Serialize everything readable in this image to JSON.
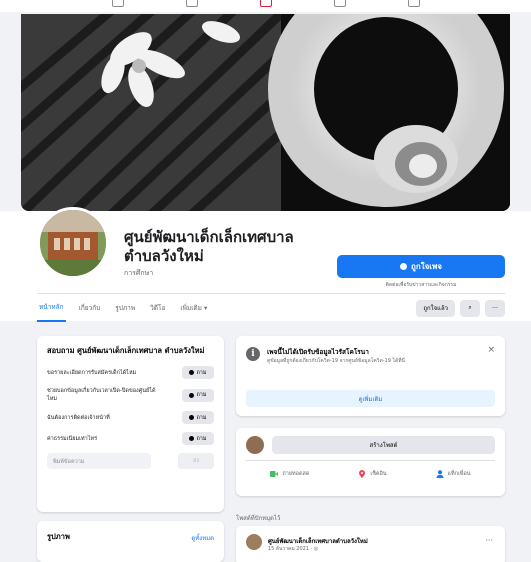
{
  "page": {
    "name": "ศูนย์พัฒนาเด็กเล็กเทศบาล ตำบลวังใหม่",
    "category": "การศึกษา",
    "like_label": "ถูกใจเพจ",
    "like_hint": "ติดต่อเพื่อรับข่าวสารและกิจกรรม"
  },
  "tabs": [
    "หน้าหลัก",
    "เกี่ยวกับ",
    "รูปภาพ",
    "วิดีโอ",
    "เพิ่มเติม ▾"
  ],
  "actions": {
    "liked": "ถูกใจแล้ว",
    "search": "⌕",
    "more": "···"
  },
  "about": {
    "title": "สอบถาม ศูนย์พัฒนาเด็กเล็กเทศบาล ตำบลวังใหม่",
    "send_label": "ถาม",
    "questions": [
      "ขอรายละเอียดการรับสมัครเด็กได้ไหม",
      "ช่วยบอกข้อมูลเกี่ยวกับเวลาเปิด-ปิดของศูนย์ได้ไหม",
      "ฉันต้องการติดต่อเจ้าหน้าที่",
      "ค่าธรรมเนียมเท่าไหร่"
    ],
    "input_placeholder": "พิมพ์ข้อความ",
    "input_send": "ส่ง"
  },
  "photos": {
    "title": "รูปภาพ",
    "see_all": "ดูทั้งหมด"
  },
  "notice": {
    "title": "เพจนี้ไม่ได้เปิดรับข้อมูลไวรัสโคโรนา",
    "body": "ดูข้อมูลที่ถูกต้องเกี่ยวกับโควิด-19 จากศูนย์ข้อมูลโควิด-19 ได้ที่นี่",
    "close": "×",
    "learn_more": "ดูเพิ่มเติม"
  },
  "composer": {
    "placeholder": "สร้างโพสต์",
    "options": [
      "ถ่ายทอดสด",
      "เช็คอิน",
      "แท็กเพื่อน"
    ],
    "option_colors": [
      "#45bd62",
      "#f3425f",
      "#1877f2"
    ]
  },
  "feed": {
    "label": "โพสต์ที่ปักหมุดไว้",
    "post_author": "ศูนย์พัฒนาเด็กเล็กเทศบาลตำบลวังใหม่",
    "post_time": "15 ธันวาคม 2021 · ◎",
    "more": "···"
  }
}
